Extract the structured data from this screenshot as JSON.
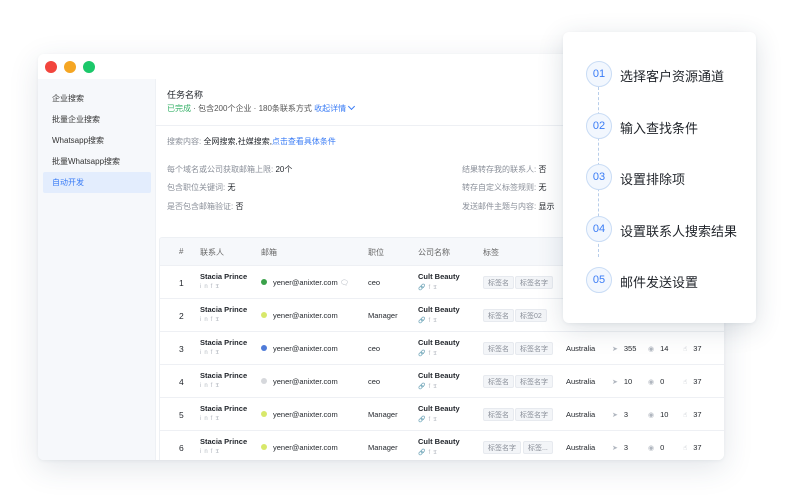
{
  "sidebar": {
    "items": [
      {
        "label": "企业搜索",
        "active": false
      },
      {
        "label": "批量企业搜索",
        "active": false
      },
      {
        "label": "Whatsapp搜索",
        "active": false
      },
      {
        "label": "批量Whatsapp搜索",
        "active": false
      },
      {
        "label": "自动开发",
        "active": true
      }
    ]
  },
  "task": {
    "title": "任务名称",
    "status": "已完成",
    "summary": " · 包含200个企业 · 180条联系方式 ",
    "toggle": "收起详情"
  },
  "conditions": {
    "search_label": "搜索内容:",
    "search_value": "全网搜索,社媒搜索,",
    "search_link": "点击查看具体条件",
    "left": [
      {
        "label": "每个域名或公司获取邮箱上限:",
        "value": "20个"
      },
      {
        "label": "包含职位关键词:",
        "value": "无"
      },
      {
        "label": "是否包含邮箱验证:",
        "value": "否"
      }
    ],
    "right": [
      {
        "label": "结果转存我的联系人:",
        "value": "否"
      },
      {
        "label": "转存自定义标签规则:",
        "value": "无"
      },
      {
        "label": "发送邮件主题与内容:",
        "value": "显示"
      }
    ]
  },
  "table": {
    "headers": [
      "#",
      "联系人",
      "邮箱",
      "职位",
      "公司名称",
      "标签"
    ],
    "social_icons": [
      "linkedin-icon",
      "facebook-icon",
      "twitter-icon"
    ],
    "rows": [
      {
        "num": "1",
        "name": "Stacia Prince",
        "email": "yener@anixter.com",
        "email_status": "#3aa14a",
        "role": "ceo",
        "company": "Cult Beauty",
        "tags": [
          "标签名",
          "标签名字"
        ],
        "country": "",
        "sent": "",
        "opened": "",
        "clicked": ""
      },
      {
        "num": "2",
        "name": "Stacia Prince",
        "email": "yener@anixter.com",
        "email_status": "#d8e86a",
        "role": "Manager",
        "company": "Cult Beauty",
        "tags": [
          "标签名",
          "标签02"
        ],
        "country": "",
        "sent": "",
        "opened": "",
        "clicked": ""
      },
      {
        "num": "3",
        "name": "Stacia Prince",
        "email": "yener@anixter.com",
        "email_status": "#4f7bd8",
        "role": "ceo",
        "company": "Cult Beauty",
        "tags": [
          "标签名",
          "标签名字"
        ],
        "country": "Australia",
        "sent": "355",
        "opened": "14",
        "clicked": "37"
      },
      {
        "num": "4",
        "name": "Stacia Prince",
        "email": "yener@anixter.com",
        "email_status": "#d6d8dc",
        "role": "ceo",
        "company": "Cult Beauty",
        "tags": [
          "标签名",
          "标签名字"
        ],
        "country": "Australia",
        "sent": "10",
        "opened": "0",
        "clicked": "37"
      },
      {
        "num": "5",
        "name": "Stacia Prince",
        "email": "yener@anixter.com",
        "email_status": "#d8e86a",
        "role": "Manager",
        "company": "Cult Beauty",
        "tags": [
          "标签名",
          "标签名字"
        ],
        "country": "Australia",
        "sent": "3",
        "opened": "10",
        "clicked": "37"
      },
      {
        "num": "6",
        "name": "Stacia Prince",
        "email": "yener@anixter.com",
        "email_status": "#d8e86a",
        "role": "Manager",
        "company": "Cult Beauty",
        "tags": [
          "标签名字",
          "标签..."
        ],
        "country": "Australia",
        "sent": "3",
        "opened": "0",
        "clicked": "37"
      }
    ]
  },
  "steps": [
    {
      "num": "01",
      "label": "选择客户资源通道"
    },
    {
      "num": "02",
      "label": "输入查找条件"
    },
    {
      "num": "03",
      "label": "设置排除项"
    },
    {
      "num": "04",
      "label": "设置联系人搜索结果"
    },
    {
      "num": "05",
      "label": "邮件发送设置"
    }
  ],
  "colors": {
    "accent": "#3a7cf6",
    "success": "#38b26a",
    "active_bg": "#e3edfd"
  }
}
